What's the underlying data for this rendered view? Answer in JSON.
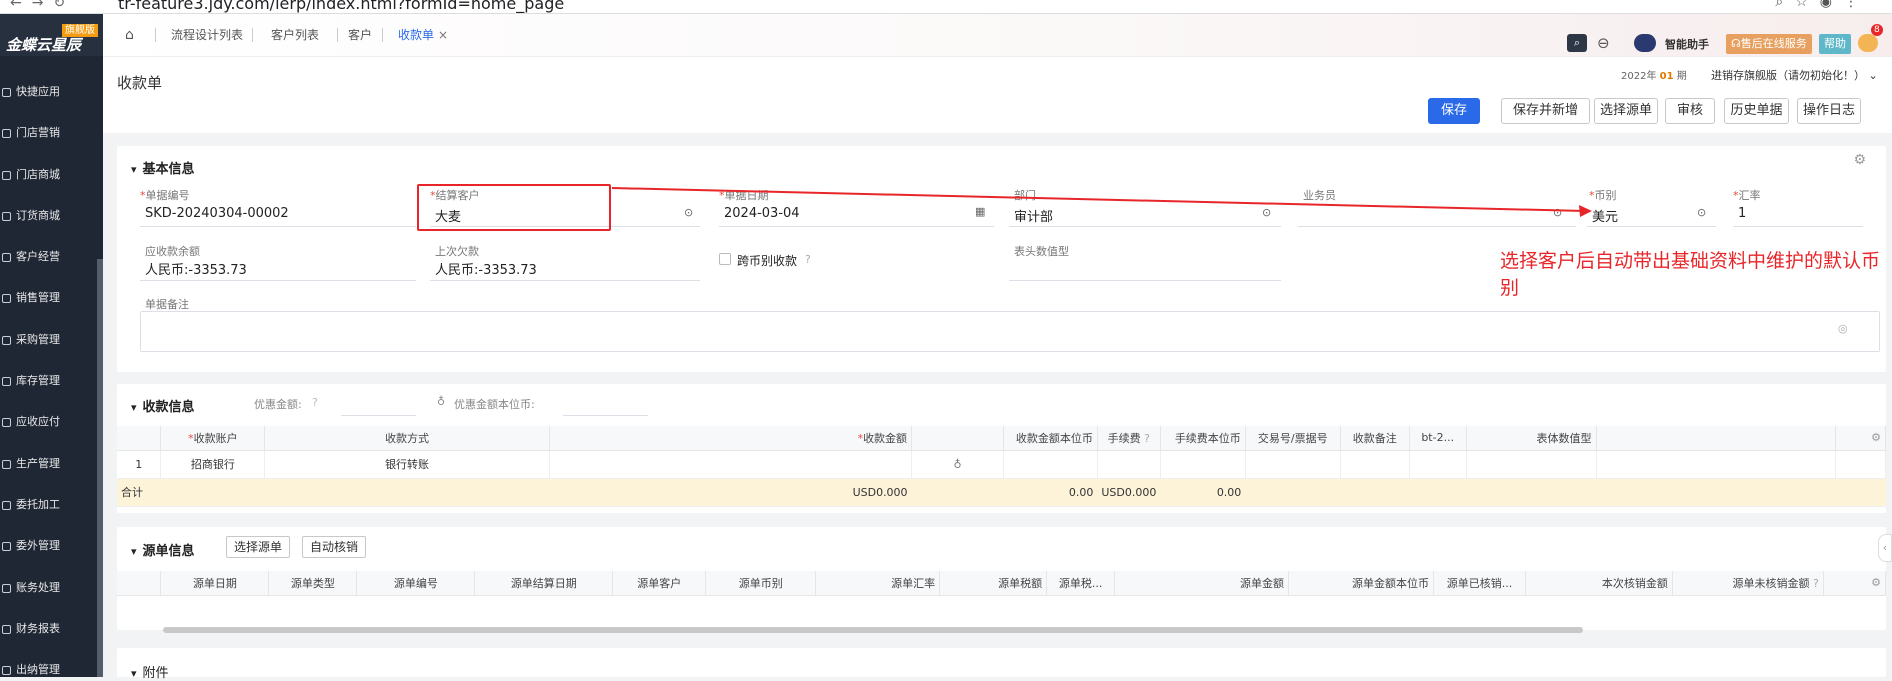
{
  "browser": {
    "url": "tr-feature3.jdy.com/ierp/index.html?formId=home_page"
  },
  "sidebar": {
    "logo": "金蝶云星辰",
    "edition": "旗舰版",
    "items": [
      "快捷应用",
      "门店营销",
      "门店商城",
      "订货商城",
      "客户经营",
      "销售管理",
      "采购管理",
      "库存管理",
      "应收应付",
      "生产管理",
      "委托加工",
      "委外管理",
      "账务处理",
      "财务报表",
      "出纳管理"
    ]
  },
  "tabs": [
    "流程设计列表",
    "客户列表",
    "客户",
    "收款单"
  ],
  "header": {
    "assistant": "智能助手",
    "service": "售后在线服务",
    "help": "帮助",
    "badge": "8"
  },
  "page": {
    "title": "收款单",
    "period_prefix": "2022年",
    "period_num": "01",
    "period_suffix": "期",
    "org": "进销存旗舰版（请勿初始化！）"
  },
  "toolbar": [
    "保存",
    "保存并新增",
    "选择源单",
    "审核",
    "历史单据",
    "操作日志"
  ],
  "basic": {
    "section": "基本信息",
    "bill_no_label": "单据编号",
    "bill_no": "SKD-20240304-00002",
    "customer_label": "结算客户",
    "customer": "大麦",
    "date_label": "单据日期",
    "date": "2024-03-04",
    "dept_label": "部门",
    "dept": "审计部",
    "salesman_label": "业务员",
    "salesman": "",
    "currency_label": "币别",
    "currency": "美元",
    "rate_label": "汇率",
    "rate": "1",
    "receivable_label": "应收款余额",
    "receivable": "人民币:-3353.73",
    "last_label": "上次欠款",
    "last": "人民币:-3353.73",
    "cross_label": "跨币别收款",
    "header_num_label": "表头数值型",
    "remark_label": "单据备注"
  },
  "annotation": "选择客户后自动带出基础资料中维护的默认币别",
  "receipt": {
    "section": "收款信息",
    "discount_label": "优惠金额:",
    "discount_base_label": "优惠金额本位币:",
    "columns": [
      "收款账户",
      "收款方式",
      "收款金额",
      "",
      "收款金额本位币",
      "手续费",
      "手续费本位币",
      "交易号/票据号",
      "收款备注",
      "bt-2...",
      "表体数值型"
    ],
    "rows": [
      [
        "1",
        "招商银行",
        "银行转账",
        "",
        "",
        "",
        "",
        "",
        "",
        "",
        "",
        "",
        ""
      ]
    ],
    "total_label": "合计",
    "total_amount": "USD0.000",
    "total_base": "0.00",
    "total_fee": "USD0.000",
    "total_fee_base": "0.00"
  },
  "source": {
    "section": "源单信息",
    "btn_select": "选择源单",
    "btn_auto": "自动核销",
    "columns": [
      "源单日期",
      "源单类型",
      "源单编号",
      "源单结算日期",
      "源单客户",
      "源单币别",
      "源单汇率",
      "源单税额",
      "源单税...",
      "源单金额",
      "源单金额本位币",
      "源单已核销...",
      "本次核销金额",
      "源单未核销金额"
    ]
  },
  "attachment": {
    "section": "附件"
  }
}
